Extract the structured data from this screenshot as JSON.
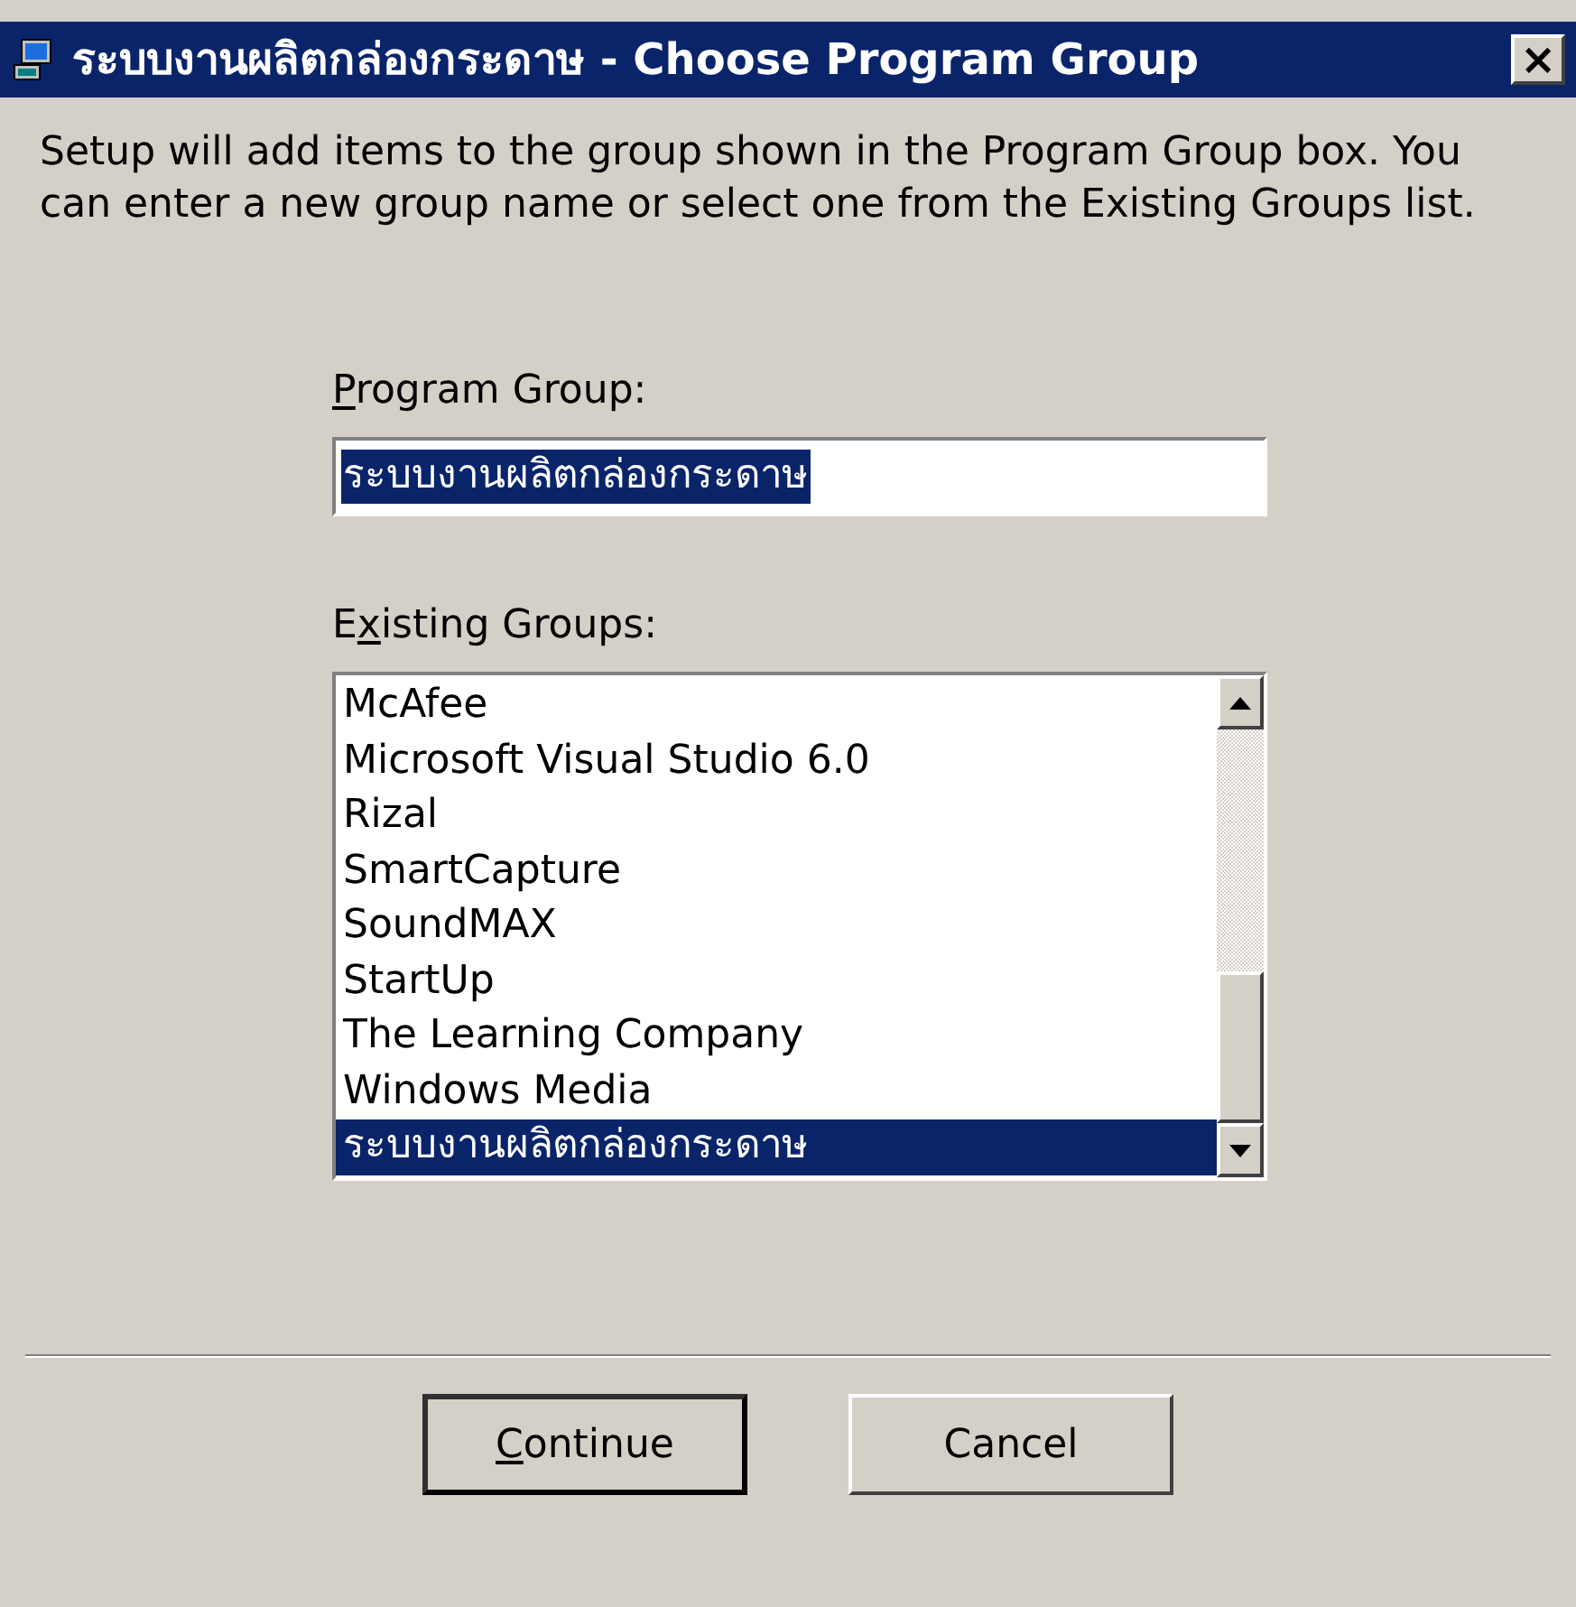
{
  "window": {
    "title": "ระบบงานผลิตกล่องกระดาษ - Choose Program Group",
    "close": "×"
  },
  "instructions": "Setup will add items to the group shown in the Program Group box. You can enter a new group name or select one from the Existing Groups list.",
  "program_group": {
    "label": {
      "key": "P",
      "post": "rogram Group:"
    },
    "value": "ระบบงานผลิตกล่องกระดาษ"
  },
  "existing_groups": {
    "label": {
      "pre": "E",
      "key": "x",
      "post": "isting Groups:"
    },
    "items": [
      {
        "text": "McAfee",
        "selected": false
      },
      {
        "text": "Microsoft Visual Studio 6.0",
        "selected": false
      },
      {
        "text": "Rizal",
        "selected": false
      },
      {
        "text": "SmartCapture",
        "selected": false
      },
      {
        "text": "SoundMAX",
        "selected": false
      },
      {
        "text": "StartUp",
        "selected": false
      },
      {
        "text": "The Learning Company",
        "selected": false
      },
      {
        "text": "Windows Media",
        "selected": false
      },
      {
        "text": "ระบบงานผลิตกล่องกระดาษ",
        "selected": true
      }
    ]
  },
  "buttons": [
    {
      "label": {
        "key": "C",
        "post": "ontinue"
      },
      "default": true
    },
    {
      "label": {
        "pre": "Cancel"
      },
      "default": false
    }
  ]
}
